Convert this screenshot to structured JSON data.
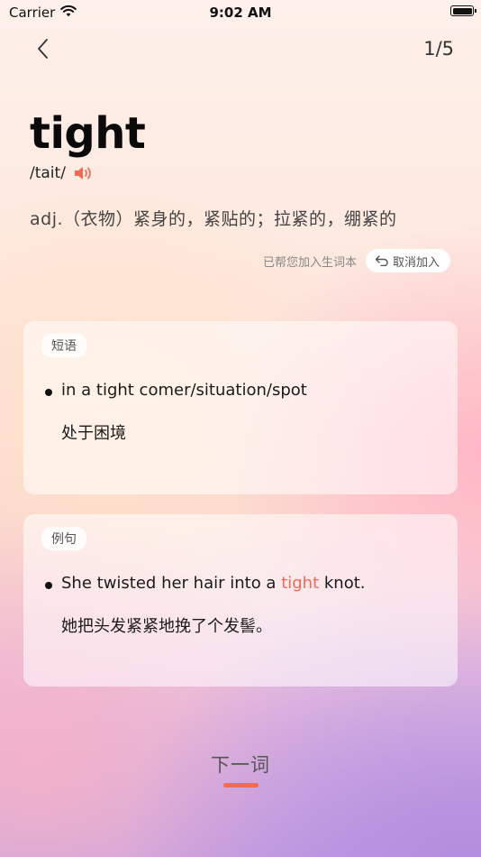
{
  "status_bar": {
    "carrier": "Carrier",
    "time": "9:02 AM"
  },
  "nav": {
    "counter": "1/5"
  },
  "word": {
    "headword": "tight",
    "phonetic": "/tait/",
    "definition": "adj.（衣物）紧身的，紧贴的；拉紧的，绷紧的"
  },
  "wordbook": {
    "status_text": "已帮您加入生词本",
    "cancel_label": "取消加入"
  },
  "phrases_card": {
    "tag": "短语",
    "phrase": "in a tight comer/situation/spot",
    "translation": "处于困境"
  },
  "examples_card": {
    "tag": "例句",
    "sentence_before": "She twisted her hair into a ",
    "sentence_highlight": "tight",
    "sentence_after": " knot.",
    "translation": "她把头发紧紧地挽了个发髻。"
  },
  "footer": {
    "next_label": "下一词"
  },
  "colors": {
    "accent": "#ef6b54",
    "highlight": "#ee6a55"
  }
}
